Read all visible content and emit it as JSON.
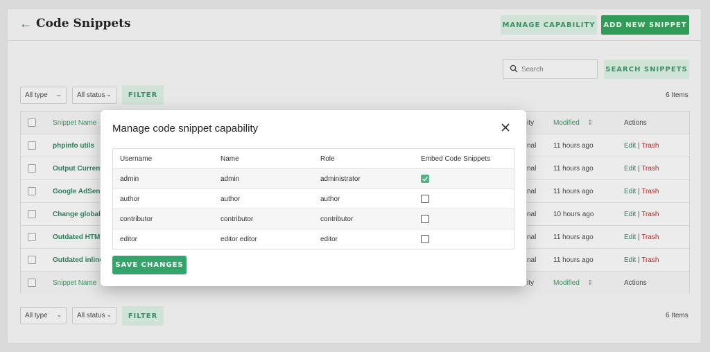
{
  "header": {
    "title": "Code Snippets",
    "manage_capability": "MANAGE CAPABILITY",
    "add_new_snippet": "ADD NEW SNIPPET"
  },
  "search": {
    "placeholder": "Search",
    "button": "SEARCH SNIPPETS"
  },
  "filters_top": {
    "type": "All type",
    "status": "All status",
    "filter": "FILTER",
    "count": "6 Items"
  },
  "filters_bottom": {
    "type": "All type",
    "status": "All status",
    "filter": "FILTER",
    "count": "6 Items"
  },
  "table": {
    "head": {
      "name": "Snippet Name",
      "priority_tail": "ity",
      "modified": "Modified",
      "actions": "Actions"
    },
    "rows": [
      {
        "name": "phpinfo utils",
        "tail": "nal",
        "modified": "11 hours ago"
      },
      {
        "name": "Output Current",
        "tail": "nal",
        "modified": "11 hours ago"
      },
      {
        "name": "Google AdSens",
        "tail": "nal",
        "modified": "11 hours ago"
      },
      {
        "name": "Change global",
        "tail": "nal",
        "modified": "10 hours ago"
      },
      {
        "name": "Outdated HTM",
        "tail": "nal",
        "modified": "11 hours ago"
      },
      {
        "name": "Outdated inline",
        "tail": "nal",
        "modified": "11 hours ago"
      }
    ],
    "foot": {
      "name": "Snippet Name",
      "priority_tail": "ity",
      "modified": "Modified",
      "actions": "Actions"
    },
    "edit": "Edit",
    "sep": "|",
    "trash": "Trash"
  },
  "modal": {
    "title": "Manage code snippet capability",
    "columns": [
      "Username",
      "Name",
      "Role",
      "Embed Code Snippets"
    ],
    "rows": [
      {
        "username": "admin",
        "name": "admin",
        "role": "administrator",
        "embed": true
      },
      {
        "username": "author",
        "name": "author",
        "role": "author",
        "embed": false
      },
      {
        "username": "contributor",
        "name": "contributor",
        "role": "contributor",
        "embed": false
      },
      {
        "username": "editor",
        "name": "editor editor",
        "role": "editor",
        "embed": false
      }
    ],
    "save": "SAVE CHANGES"
  },
  "colors": {
    "accent": "#2f9c57",
    "trash": "#b02a2a",
    "checked": "#56b387"
  }
}
